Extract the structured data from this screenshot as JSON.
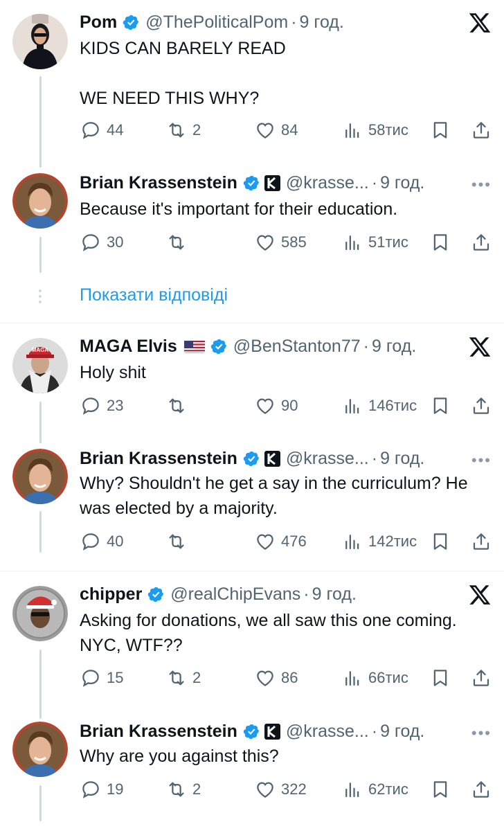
{
  "show_replies": "Показати відповіді",
  "tweets": [
    {
      "name": "Pom",
      "handle": "@ThePoliticalPom",
      "dot": "·",
      "time": "9 год.",
      "text": "KIDS CAN BARELY READ\n\nWE NEED THIS WHY?",
      "replies": "44",
      "retweets": "2",
      "likes": "84",
      "views": "58тис"
    },
    {
      "name": "Brian Krassenstein",
      "handle": "@krasse...",
      "dot": "·",
      "time": "9 год.",
      "text": "Because it's important for their education.",
      "replies": "30",
      "retweets": "",
      "likes": "585",
      "views": "51тис"
    },
    {
      "name": "MAGA Elvis",
      "handle": "@BenStanton77",
      "dot": "·",
      "time": "9 год.",
      "text": "Holy shit",
      "replies": "23",
      "retweets": "",
      "likes": "90",
      "views": "146тис",
      "avatar_text": "MAGA"
    },
    {
      "name": "Brian Krassenstein",
      "handle": "@krasse...",
      "dot": "·",
      "time": "9 год.",
      "text": "Why?  Shouldn't he get a say in the curriculum? He was elected by a majority.",
      "replies": "40",
      "retweets": "",
      "likes": "476",
      "views": "142тис"
    },
    {
      "name": "chipper",
      "handle": "@realChipEvans",
      "dot": "·",
      "time": "9 год.",
      "text": "Asking for donations, we all saw this one coming.  NYC, WTF??",
      "replies": "15",
      "retweets": "2",
      "likes": "86",
      "views": "66тис"
    },
    {
      "name": "Brian Krassenstein",
      "handle": "@krasse...",
      "dot": "·",
      "time": "9 год.",
      "text": "Why are you against this?",
      "replies": "19",
      "retweets": "2",
      "likes": "322",
      "views": "62тис"
    }
  ],
  "icons": {
    "reply": "reply-icon",
    "retweet": "retweet-icon",
    "like": "heart-icon",
    "views": "views-icon",
    "bookmark": "bookmark-icon",
    "share": "share-icon",
    "verified": "verified-badge-icon",
    "x_logo": "x-logo-icon",
    "more": "more-icon"
  },
  "colors": {
    "verified": "#1d9bf0",
    "link": "#1d9bf0",
    "muted": "#536471",
    "thread_line": "#cfd9de"
  }
}
